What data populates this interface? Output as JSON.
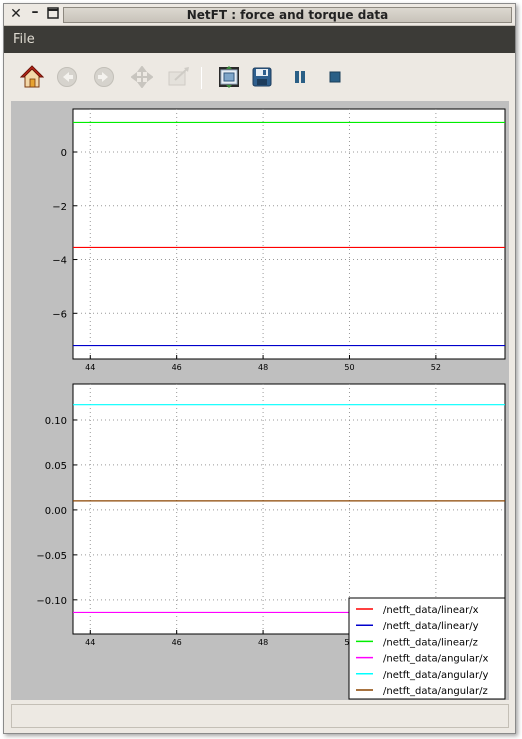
{
  "window": {
    "title": "NetFT : force and torque data"
  },
  "menubar": {
    "file_label": "File"
  },
  "toolbar": {
    "items": [
      "home-icon",
      "back-icon",
      "forward-icon",
      "pan-icon",
      "zoom-icon",
      "subplots-icon",
      "save-icon",
      "pause-icon",
      "stop-icon"
    ]
  },
  "colors": {
    "menubar_bg": "#3c3b37",
    "plot_bg": "#bfbfbf",
    "linear_x": "#ff0000",
    "linear_y": "#0000cc",
    "linear_z": "#00ee00",
    "angular_x": "#ff00ff",
    "angular_y": "#00ffff",
    "angular_z": "#8b4500"
  },
  "chart_data": [
    {
      "type": "line",
      "title": "",
      "xlabel": "",
      "ylabel": "",
      "xlim": [
        43.6,
        53.6
      ],
      "ylim": [
        -7.7,
        1.6
      ],
      "xticks": [
        44,
        46,
        48,
        50,
        52
      ],
      "yticks": [
        0,
        -2,
        -4,
        -6
      ],
      "grid": true,
      "series": [
        {
          "name": "/netft_data/linear/x",
          "color": "#ff0000",
          "x": [
            43.6,
            53.6
          ],
          "y": [
            -3.55,
            -3.55
          ]
        },
        {
          "name": "/netft_data/linear/y",
          "color": "#0000cc",
          "x": [
            43.6,
            53.6
          ],
          "y": [
            -7.2,
            -7.2
          ]
        },
        {
          "name": "/netft_data/linear/z",
          "color": "#00ee00",
          "x": [
            43.6,
            53.6
          ],
          "y": [
            1.1,
            1.1
          ]
        }
      ]
    },
    {
      "type": "line",
      "title": "",
      "xlabel": "",
      "ylabel": "",
      "xlim": [
        43.6,
        53.6
      ],
      "ylim": [
        -0.138,
        0.14
      ],
      "xticks": [
        44,
        46,
        48,
        50,
        52
      ],
      "yticks": [
        0.1,
        0.05,
        0.0,
        -0.05,
        -0.1
      ],
      "grid": true,
      "legend_position": "bottom-right",
      "series": [
        {
          "name": "/netft_data/angular/x",
          "color": "#ff00ff",
          "x": [
            43.6,
            53.6
          ],
          "y": [
            -0.114,
            -0.114
          ]
        },
        {
          "name": "/netft_data/angular/y",
          "color": "#00ffff",
          "x": [
            43.6,
            53.6
          ],
          "y": [
            0.117,
            0.117
          ]
        },
        {
          "name": "/netft_data/angular/z",
          "color": "#8b4500",
          "x": [
            43.6,
            53.6
          ],
          "y": [
            0.01,
            0.01
          ]
        }
      ]
    }
  ],
  "legend": {
    "entries": [
      {
        "label": "/netft_data/linear/x",
        "color": "#ff0000"
      },
      {
        "label": "/netft_data/linear/y",
        "color": "#0000cc"
      },
      {
        "label": "/netft_data/linear/z",
        "color": "#00ee00"
      },
      {
        "label": "/netft_data/angular/x",
        "color": "#ff00ff"
      },
      {
        "label": "/netft_data/angular/y",
        "color": "#00ffff"
      },
      {
        "label": "/netft_data/angular/z",
        "color": "#8b4500"
      }
    ]
  },
  "tick_labels": {
    "top_y": [
      "0",
      "−2",
      "−4",
      "−6"
    ],
    "bottom_y": [
      "0.10",
      "0.05",
      "0.00",
      "−0.05",
      "−0.10"
    ],
    "x": [
      "44",
      "46",
      "48",
      "50",
      "52"
    ]
  }
}
